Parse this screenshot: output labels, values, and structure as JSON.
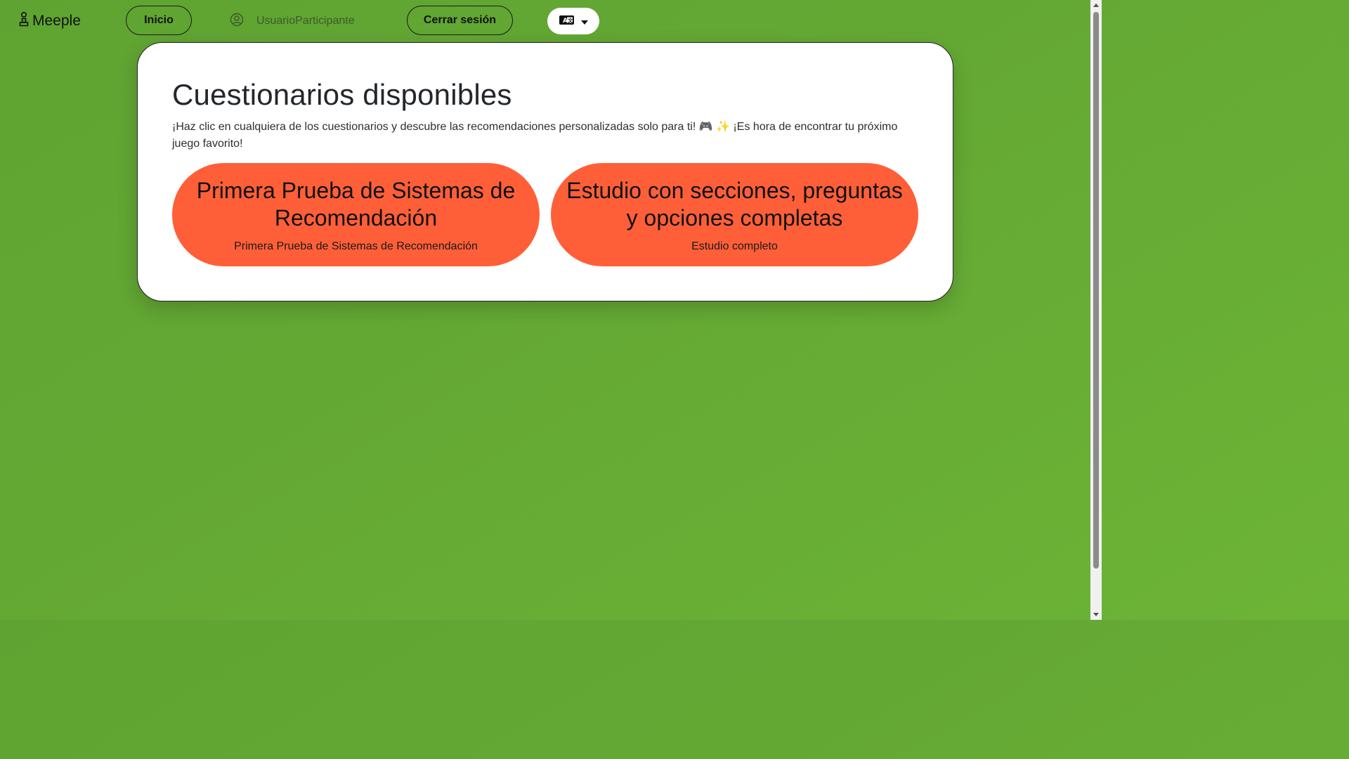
{
  "navbar": {
    "brand": "Meeple",
    "brand_icon": "meeple-icon",
    "home_label": "Inicio",
    "username": "UsuarioParticipante",
    "user_icon": "user-circle-icon",
    "logout_label": "Cerrar sesión",
    "language_icon": "translate-icon",
    "dropdown_icon": "caret-down-icon"
  },
  "main": {
    "title": "Cuestionarios disponibles",
    "subtitle": "¡Haz clic en cualquiera de los cuestionarios y descubre las recomendaciones personalizadas solo para ti! 🎮 ✨ ¡Es hora de encontrar tu próximo juego favorito!",
    "quizzes": [
      {
        "title": "Primera Prueba de Sistemas de Recomendación",
        "description": "Primera Prueba de Sistemas de Recomendación"
      },
      {
        "title": "Estudio con secciones, preguntas y opciones completas",
        "description": "Estudio completo"
      }
    ]
  },
  "colors": {
    "background": "#64a834",
    "card": "#ffffff",
    "quiz_button": "#ff5f38"
  }
}
